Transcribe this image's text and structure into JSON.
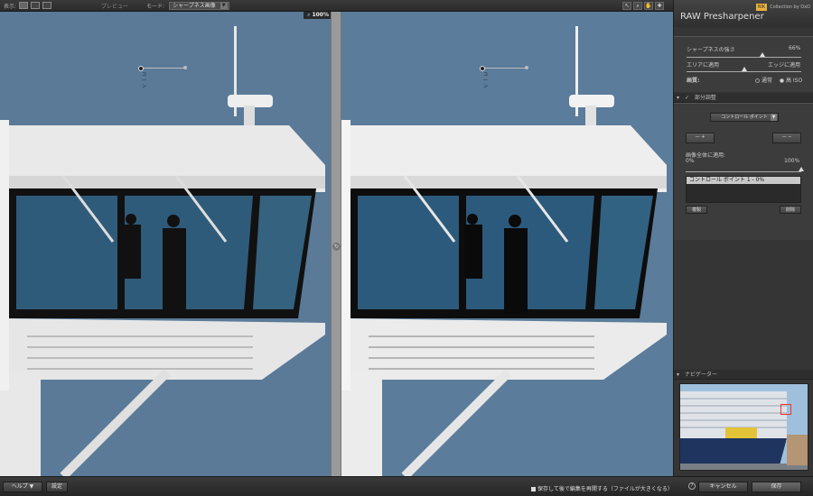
{
  "toolbar": {
    "view_label": "表示:",
    "preview_label": "プレビュー",
    "mode_label": "モード:",
    "mode_value": "シャープネス画像",
    "zoom_level": "100%"
  },
  "image": {
    "control_point_label": "コ—ン",
    "divider_icon": "sync-icon"
  },
  "panel": {
    "title": "RAW Presharpener",
    "brand": "Collection by DxO",
    "brand_logo": "NIK",
    "sharpness_label": "シャープネスの強さ",
    "sharpness_value": "66%",
    "sharpness_fraction": 0.66,
    "area_label": "エリアに適用",
    "edge_label": "エッジに適用",
    "area_edge_fraction": 0.5,
    "quality_label": "画質:",
    "quality_options": [
      "通常",
      "高 ISO"
    ],
    "quality_selected": 1,
    "partial_section": "部分調整",
    "control_point_dropdown": "コントロール ポイント",
    "apply_whole_label": "画像全体に適用:",
    "apply_min": "0%",
    "apply_max": "100%",
    "apply_fraction": 1.0,
    "cp_list_item": "コントロール ポイント 1 - 0%",
    "copy_button": "複製",
    "delete_button": "削除",
    "navigator_section": "ナビゲーター"
  },
  "bottom": {
    "help_button": "ヘルプ ▼",
    "settings_button": "設定",
    "save_note": "保存して後で編集を再開する（ファイルが大きくなる）",
    "cancel_button": "キャンセル",
    "save_button": "保存"
  },
  "colors": {
    "sky": "#5a7a98",
    "panel_bg": "#353535",
    "accent_logo": "#e8b43a"
  }
}
